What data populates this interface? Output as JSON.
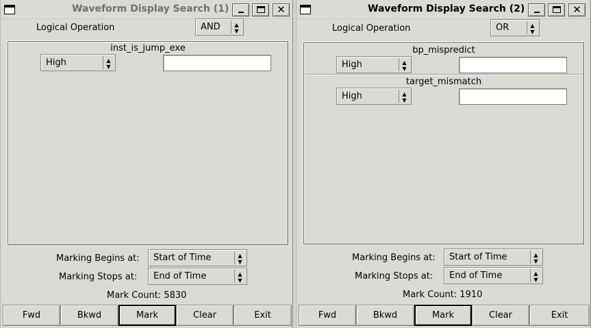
{
  "win1": {
    "title": "Waveform Display Search (1)",
    "logical_label": "Logical Operation",
    "logical_value": "AND",
    "conditions": [
      {
        "signal": "inst_is_jump_exe",
        "level": "High",
        "value": ""
      }
    ],
    "begins_label": "Marking Begins at:",
    "begins_value": "Start of Time",
    "stops_label": "Marking Stops at:",
    "stops_value": "End of Time",
    "mark_count": "Mark Count: 5830",
    "buttons": {
      "fwd": "Fwd",
      "bkwd": "Bkwd",
      "mark": "Mark",
      "clear": "Clear",
      "exit": "Exit"
    }
  },
  "win2": {
    "title": "Waveform Display Search (2)",
    "logical_label": "Logical Operation",
    "logical_value": "OR",
    "conditions": [
      {
        "signal": "bp_mispredict",
        "level": "High",
        "value": ""
      },
      {
        "signal": "target_mismatch",
        "level": "High",
        "value": ""
      }
    ],
    "begins_label": "Marking Begins at:",
    "begins_value": "Start of Time",
    "stops_label": "Marking Stops at:",
    "stops_value": "End of Time",
    "mark_count": "Mark Count: 1910",
    "buttons": {
      "fwd": "Fwd",
      "bkwd": "Bkwd",
      "mark": "Mark",
      "clear": "Clear",
      "exit": "Exit"
    }
  },
  "titlebar_icons": {
    "menu": "window-menu-icon",
    "minimize": "minimize-icon",
    "maximize": "maximize-icon",
    "close": "close-icon"
  }
}
